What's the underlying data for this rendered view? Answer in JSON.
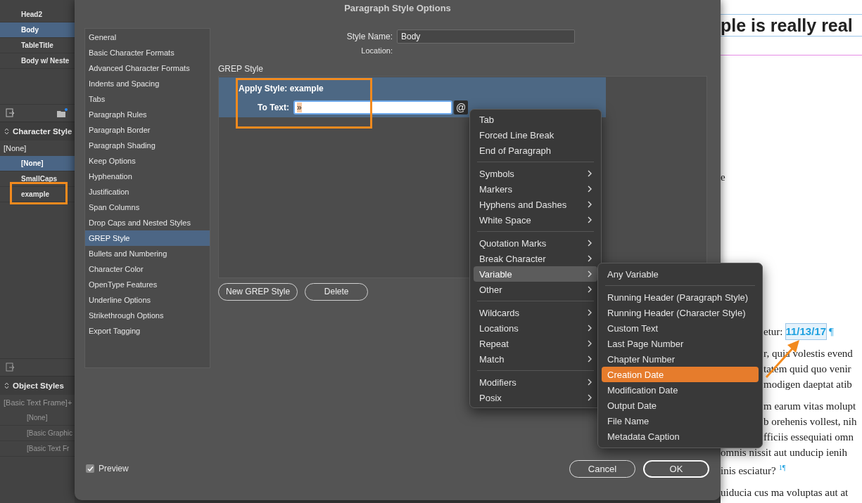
{
  "styles_panel": {
    "paragraph_styles": [
      {
        "label": "Head2",
        "selected": false
      },
      {
        "label": "Body",
        "selected": true
      },
      {
        "label": "TableTitle",
        "selected": false
      },
      {
        "label": "Body w/ Neste",
        "selected": false
      }
    ],
    "character_styles": {
      "title": "Character Style",
      "current": "[None]",
      "items": [
        {
          "label": "[None]",
          "selected": true
        },
        {
          "label": "SmallCaps",
          "selected": false
        },
        {
          "label": "example",
          "selected": false
        }
      ]
    },
    "object_styles": {
      "title": "Object Styles",
      "current": "[Basic Text Frame]+",
      "items": [
        {
          "label": "[None]"
        },
        {
          "label": "[Basic Graphic"
        },
        {
          "label": "[Basic Text Fr"
        }
      ]
    }
  },
  "dialog": {
    "title": "Paragraph Style Options",
    "categories": [
      {
        "label": "General",
        "selected": false
      },
      {
        "label": "Basic Character Formats",
        "selected": false
      },
      {
        "label": "Advanced Character Formats",
        "selected": false
      },
      {
        "label": "Indents and Spacing",
        "selected": false
      },
      {
        "label": "Tabs",
        "selected": false
      },
      {
        "label": "Paragraph Rules",
        "selected": false
      },
      {
        "label": "Paragraph Border",
        "selected": false
      },
      {
        "label": "Paragraph Shading",
        "selected": false
      },
      {
        "label": "Keep Options",
        "selected": false
      },
      {
        "label": "Hyphenation",
        "selected": false
      },
      {
        "label": "Justification",
        "selected": false
      },
      {
        "label": "Span Columns",
        "selected": false
      },
      {
        "label": "Drop Caps and Nested Styles",
        "selected": false
      },
      {
        "label": "GREP Style",
        "selected": true
      },
      {
        "label": "Bullets and Numbering",
        "selected": false
      },
      {
        "label": "Character Color",
        "selected": false
      },
      {
        "label": "OpenType Features",
        "selected": false
      },
      {
        "label": "Underline Options",
        "selected": false
      },
      {
        "label": "Strikethrough Options",
        "selected": false
      },
      {
        "label": "Export Tagging",
        "selected": false
      }
    ],
    "style_name": {
      "label": "Style Name:",
      "value": "Body"
    },
    "location": {
      "label": "Location:"
    },
    "section_title": "GREP Style",
    "grep_rules": [
      {
        "apply_style": "Apply Style: example",
        "to_text_label": "To Text:",
        "to_text_value": "»",
        "selected": true
      }
    ],
    "insert_button": "@",
    "buttons": [
      "New GREP Style",
      "Delete"
    ],
    "preview": {
      "label": "Preview",
      "checked": true
    },
    "footer_buttons": [
      {
        "label": "Cancel",
        "default": false
      },
      {
        "label": "OK",
        "default": true
      }
    ]
  },
  "special_characters_menu": {
    "groups": [
      {
        "items": [
          {
            "label": "Tab",
            "submenu": false,
            "selected": false
          },
          {
            "label": "Forced Line Break",
            "submenu": false,
            "selected": false
          },
          {
            "label": "End of Paragraph",
            "submenu": false,
            "selected": false
          }
        ]
      },
      {
        "items": [
          {
            "label": "Symbols",
            "submenu": true,
            "selected": false
          },
          {
            "label": "Markers",
            "submenu": true,
            "selected": false
          },
          {
            "label": "Hyphens and Dashes",
            "submenu": true,
            "selected": false
          },
          {
            "label": "White Space",
            "submenu": true,
            "selected": false
          }
        ]
      },
      {
        "items": [
          {
            "label": "Quotation Marks",
            "submenu": true,
            "selected": false
          },
          {
            "label": "Break Character",
            "submenu": true,
            "selected": false
          },
          {
            "label": "Variable",
            "submenu": true,
            "selected": true
          },
          {
            "label": "Other",
            "submenu": true,
            "selected": false
          }
        ]
      },
      {
        "items": [
          {
            "label": "Wildcards",
            "submenu": true,
            "selected": false
          },
          {
            "label": "Locations",
            "submenu": true,
            "selected": false
          },
          {
            "label": "Repeat",
            "submenu": true,
            "selected": false
          },
          {
            "label": "Match",
            "submenu": true,
            "selected": false
          }
        ]
      },
      {
        "items": [
          {
            "label": "Modifiers",
            "submenu": true,
            "selected": false
          },
          {
            "label": "Posix",
            "submenu": true,
            "selected": false
          }
        ]
      }
    ]
  },
  "variable_submenu": {
    "groups": [
      {
        "items": [
          {
            "label": "Any Variable",
            "submenu": false,
            "selected": false
          }
        ]
      },
      {
        "items": [
          {
            "label": "Running Header (Paragraph Style)",
            "submenu": false,
            "selected": false
          },
          {
            "label": "Running Header (Character Style)",
            "submenu": false,
            "selected": false
          },
          {
            "label": "Custom Text",
            "submenu": false,
            "selected": false
          },
          {
            "label": "Last Page Number",
            "submenu": false,
            "selected": false
          },
          {
            "label": "Chapter Number",
            "submenu": false,
            "selected": false
          },
          {
            "label": "Creation Date",
            "submenu": false,
            "selected": true
          },
          {
            "label": "Modification Date",
            "submenu": false,
            "selected": false
          },
          {
            "label": "Output Date",
            "submenu": false,
            "selected": false
          },
          {
            "label": "File Name",
            "submenu": false,
            "selected": false
          },
          {
            "label": "Metadata Caption",
            "submenu": false,
            "selected": false
          }
        ]
      }
    ]
  },
  "document": {
    "heading": "ple is really real",
    "fragment": "e",
    "date_line": {
      "text": "etur:",
      "date": "11/13/17",
      "pilcrow": "¶"
    },
    "lines_beside_menu": [
      {
        "text": "r, quia volestis evend"
      },
      {
        "text": "tatem quid quo venir"
      },
      {
        "text": "modigen daeptat atib"
      },
      {
        "text": "m earum vitas molupt"
      },
      {
        "text": "b orehenis vollest, nih"
      },
      {
        "text": "fficiis essequiati omn"
      }
    ],
    "lines_below_menu": [
      {
        "text": "omnis nissit aut unducip ienih"
      },
      {
        "text": "inis esciatur?",
        "mark": "1¶"
      },
      {
        "text": "uiducia cus ma voluptas aut at"
      }
    ]
  }
}
